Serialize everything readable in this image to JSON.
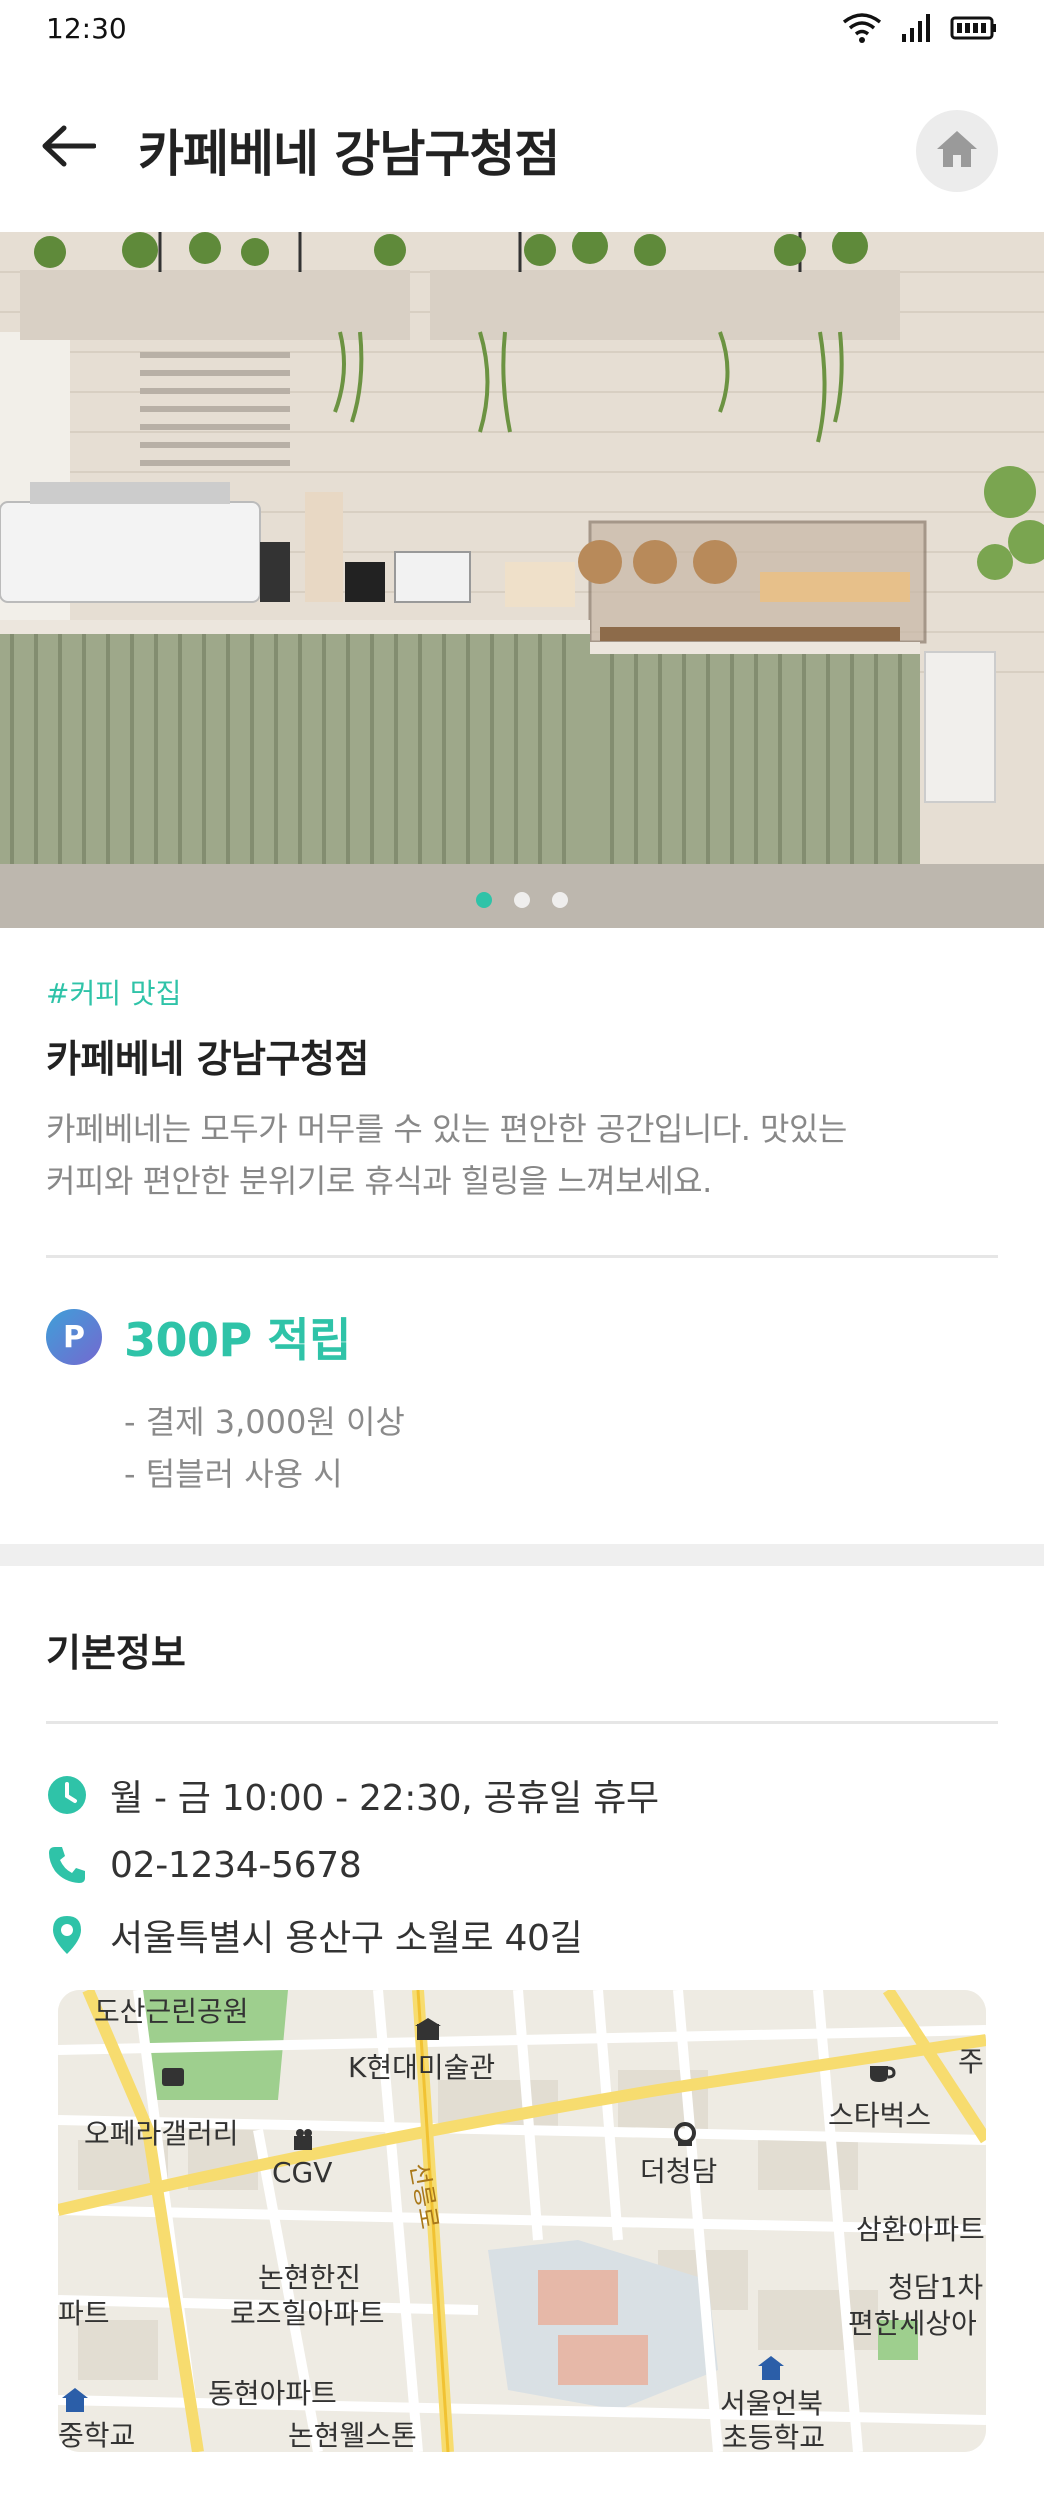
{
  "status_bar": {
    "time": "12:30"
  },
  "header": {
    "title": "카페베네 강남구청점"
  },
  "carousel": {
    "count": 3,
    "active_index": 0
  },
  "store": {
    "tag": "#커피 맛집",
    "name": "카페베네 강남구청점",
    "description_line1": "카페베네는 모두가 머무를 수 있는 편안한 공간입니다. 맛있는",
    "description_line2": "커피와 편안한 분위기로 휴식과 힐링을 느껴보세요."
  },
  "points": {
    "icon_letter": "P",
    "title": "300P 적립",
    "conditions": [
      "- 결제 3,000원 이상",
      "- 텀블러 사용 시"
    ]
  },
  "basic_info": {
    "title": "기본정보",
    "hours": "월 - 금 10:00 - 22:30, 공휴일 휴무",
    "phone": "02-1234-5678",
    "address": "서울특별시 용산구 소월로 40길"
  },
  "map": {
    "labels": {
      "park": "도산근린공원",
      "museum": "K현대미술관",
      "gallery": "오페라갤러리",
      "cgv": "CGV",
      "starbucks": "스타벅스",
      "the_chungdam": "더청담",
      "samhwan": "삼환아파트",
      "cheongdam": "청담1차",
      "comfort": "편한세상아",
      "nonhyeon_hanjin": "논현한진",
      "rosehill": "로즈힐아파트",
      "apt_left": "파트",
      "donghyeon": "동현아파트",
      "school_left": "중학교",
      "nonhyeon_wells": "논현웰스톤",
      "eonbuk_1": "서울언북",
      "eonbuk_2": "초등학교",
      "road": "선릉로",
      "edge_top_right": "주"
    }
  },
  "colors": {
    "accent": "#2fc3a8",
    "text": "#222222",
    "muted": "#888888"
  }
}
